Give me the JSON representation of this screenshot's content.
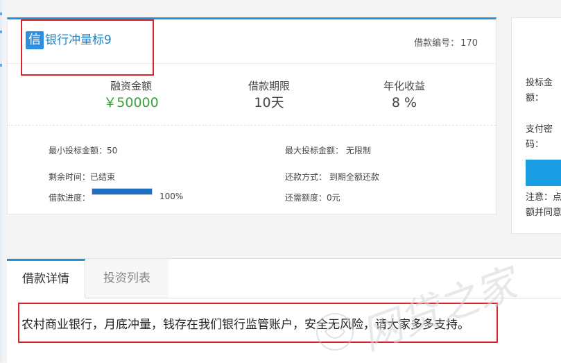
{
  "loan": {
    "badge": "信",
    "title": "银行冲量标9",
    "number_label": "借款编号：",
    "number_value": "170",
    "stats": [
      {
        "label": "融资金额",
        "value": "￥50000"
      },
      {
        "label": "借款期限",
        "value": "10天"
      },
      {
        "label": "年化收益",
        "value": "8 %"
      }
    ],
    "min_invest": "最小投标金额：50",
    "max_invest": "最大投标金额： 无限制",
    "remaining_time": "剩余时间：已结束",
    "repay_method": "还款方式： 到期全额还款",
    "progress_label": "借款进度：",
    "progress_fraction": 1.0,
    "progress_text": "100%",
    "remaining_amount": "还需额度：0元"
  },
  "side_panel": {
    "invest_amount_label": "投标金额：",
    "pay_password_label": "支付密码：",
    "note": "注意：点额并同意"
  },
  "tabs": {
    "active": "借款详情",
    "inactive": "投资列表"
  },
  "description": "农村商业银行，月底冲量，钱存在我们银行监管账户，安全无风险，请大家多多支持。",
  "watermark_text": "网贷之家",
  "colors": {
    "accent": "#1f93d6",
    "amount_green": "#3aa13a",
    "highlight_red": "#d9242d"
  }
}
